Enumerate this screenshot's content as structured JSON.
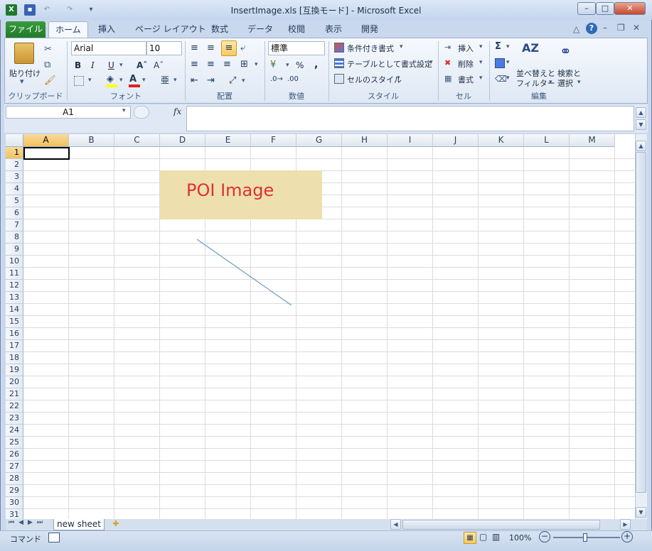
{
  "window": {
    "title": "InsertImage.xls  [互換モード] - Microsoft Excel"
  },
  "ribbon_tabs": [
    "ファイル",
    "ホーム",
    "挿入",
    "ページ レイアウト",
    "数式",
    "データ",
    "校閲",
    "表示",
    "開発"
  ],
  "clipboard": {
    "paste_label": "貼り付け",
    "group_label": "クリップボード"
  },
  "font": {
    "name": "Arial",
    "size": "10",
    "group_label": "フォント",
    "bold": "B",
    "italic": "I",
    "underline": "U"
  },
  "alignment": {
    "group_label": "配置"
  },
  "number": {
    "format": "標準",
    "percent": "%",
    "comma": ",",
    "group_label": "数値"
  },
  "styles": {
    "conditional": "条件付き書式",
    "table": "テーブルとして書式設定",
    "cell_style": "セルのスタイル",
    "group_label": "スタイル"
  },
  "cells": {
    "insert": "挿入",
    "delete": "削除",
    "format": "書式",
    "group_label": "セル"
  },
  "editing": {
    "sort_line1": "並べ替えと",
    "sort_line2": "フィルター",
    "find_line1": "検索と",
    "find_line2": "選択",
    "group_label": "編集"
  },
  "formula_bar": {
    "name_box": "A1",
    "fx": "fx",
    "value": ""
  },
  "grid": {
    "columns": [
      "A",
      "B",
      "C",
      "D",
      "E",
      "F",
      "G",
      "H",
      "I",
      "J",
      "K",
      "L",
      "M"
    ],
    "rows": [
      "1",
      "2",
      "3",
      "4",
      "5",
      "6",
      "7",
      "8",
      "9",
      "10",
      "11",
      "12",
      "13",
      "14",
      "15",
      "16",
      "17",
      "18",
      "19",
      "20",
      "21",
      "22",
      "23",
      "24",
      "25",
      "26",
      "27",
      "28",
      "29",
      "30",
      "31"
    ],
    "selected_cell": "A1"
  },
  "image": {
    "text": "POI Image"
  },
  "sheet": {
    "name": "new sheet"
  },
  "status": {
    "mode": "コマンド",
    "zoom": "100%"
  },
  "colors": {
    "image_fill": "#ede0ae",
    "image_text": "#e03030",
    "line": "#6b9bc7",
    "file_tab": "#2a8a30"
  }
}
